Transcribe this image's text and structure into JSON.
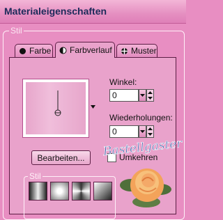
{
  "window": {
    "title": "Materialeigenschaften"
  },
  "stil_group": {
    "legend": "Stil"
  },
  "tabs": [
    {
      "label": "Farbe",
      "icon": "filled-circle-icon",
      "active": false
    },
    {
      "label": "Farbverlauf",
      "icon": "half-circle-icon",
      "active": true
    },
    {
      "label": "Muster",
      "icon": "pattern-icon",
      "active": false
    }
  ],
  "gradient": {
    "preview_colors": [
      "#e7a6cb",
      "#f0bedb"
    ],
    "dropdown_icon": "triangle-down-icon"
  },
  "winkel": {
    "label": "Winkel:",
    "value": "0"
  },
  "wiederholungen": {
    "label": "Wiederholungen:",
    "value": "0"
  },
  "edit_button": {
    "label": "Bearbeiten..."
  },
  "umkehren": {
    "label": "Umkehren",
    "checked": false
  },
  "style_group": {
    "legend": "Stil",
    "styles": [
      "linear",
      "rectangular",
      "sunburst",
      "radial"
    ]
  },
  "watermark": {
    "text": "Bastellgaster"
  },
  "colors": {
    "accent": "#e88ec2",
    "panel": "#e9a2cb",
    "title_text": "#1c2a5a"
  }
}
